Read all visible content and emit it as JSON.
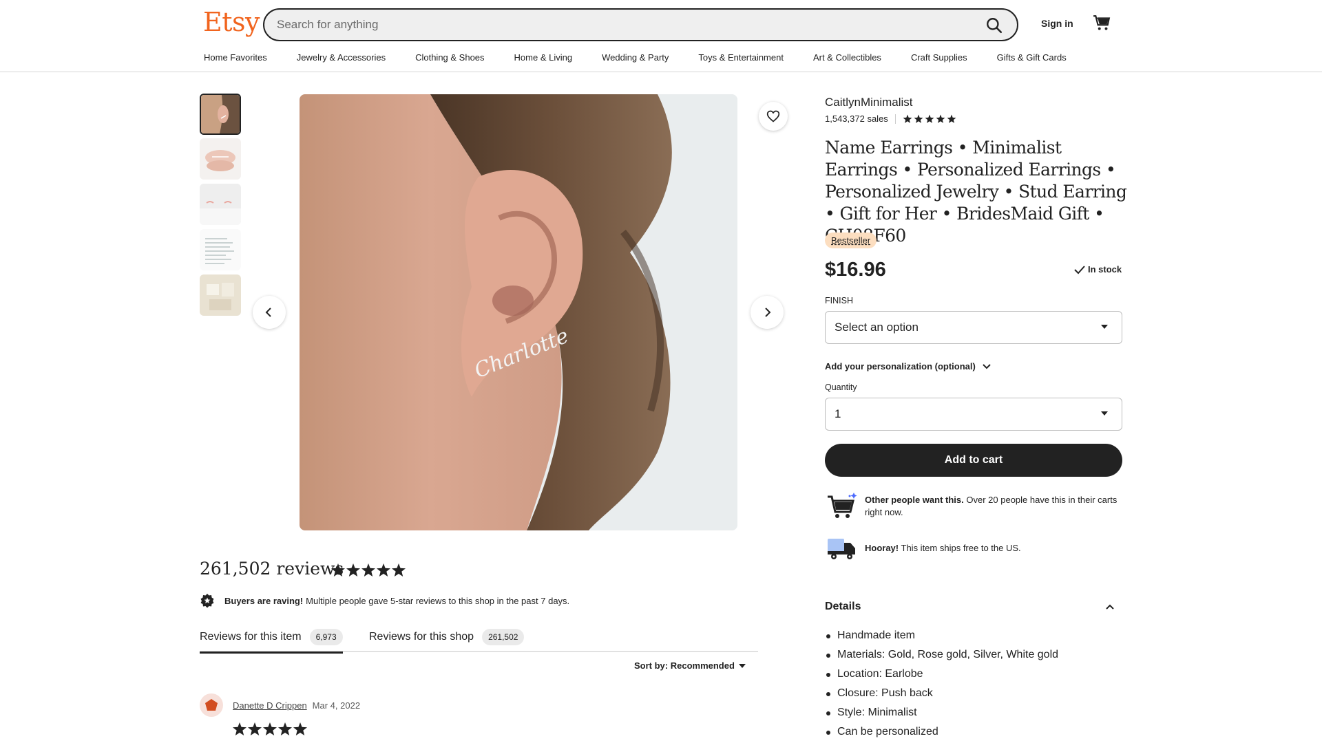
{
  "header": {
    "logo": "Etsy",
    "search_placeholder": "Search for anything",
    "signin": "Sign in"
  },
  "nav": [
    "Home Favorites",
    "Jewelry & Accessories",
    "Clothing & Shoes",
    "Home & Living",
    "Wedding & Party",
    "Toys & Entertainment",
    "Art & Collectibles",
    "Craft Supplies",
    "Gifts & Gift Cards"
  ],
  "product": {
    "shop_name": "CaitlynMinimalist",
    "sales": "1,543,372 sales",
    "rating_stars": 5,
    "title": "Name Earrings • Minimalist Earrings • Personalized Earrings • Personalized Jewelry • Stud Earring • Gift for Her • BridesMaid Gift • CH08F60",
    "badge": "Bestseller",
    "price": "$16.96",
    "stock": "In stock",
    "finish_label": "FINISH",
    "finish_value": "Select an option",
    "personalization": "Add your personalization (optional)",
    "quantity_label": "Quantity",
    "quantity_value": "1",
    "add_to_cart": "Add to cart",
    "demand_bold": "Other people want this.",
    "demand_text": "Over 20 people have this in their carts right now.",
    "ship_bold": "Hooray!",
    "ship_text": "This item ships free to the US.",
    "image_text": "Charlotte"
  },
  "details": {
    "heading": "Details",
    "items": [
      "Handmade item",
      "Materials: Gold, Rose gold, Silver, White gold",
      "Location: Earlobe",
      "Closure: Push back",
      "Style: Minimalist",
      "Can be personalized"
    ]
  },
  "reviews": {
    "title": "261,502 reviews",
    "raving_bold": "Buyers are raving!",
    "raving_text": "Multiple people gave 5-star reviews to this shop in the past 7 days.",
    "tab_item": "Reviews for this item",
    "tab_item_count": "6,973",
    "tab_shop": "Reviews for this shop",
    "tab_shop_count": "261,502",
    "sort": "Sort by: Recommended",
    "reviewer": "Danette D Crippen",
    "date": "Mar 4, 2022"
  },
  "colors": {
    "brand": "#f1641e",
    "button": "#222222",
    "badge": "#fcdec0"
  }
}
